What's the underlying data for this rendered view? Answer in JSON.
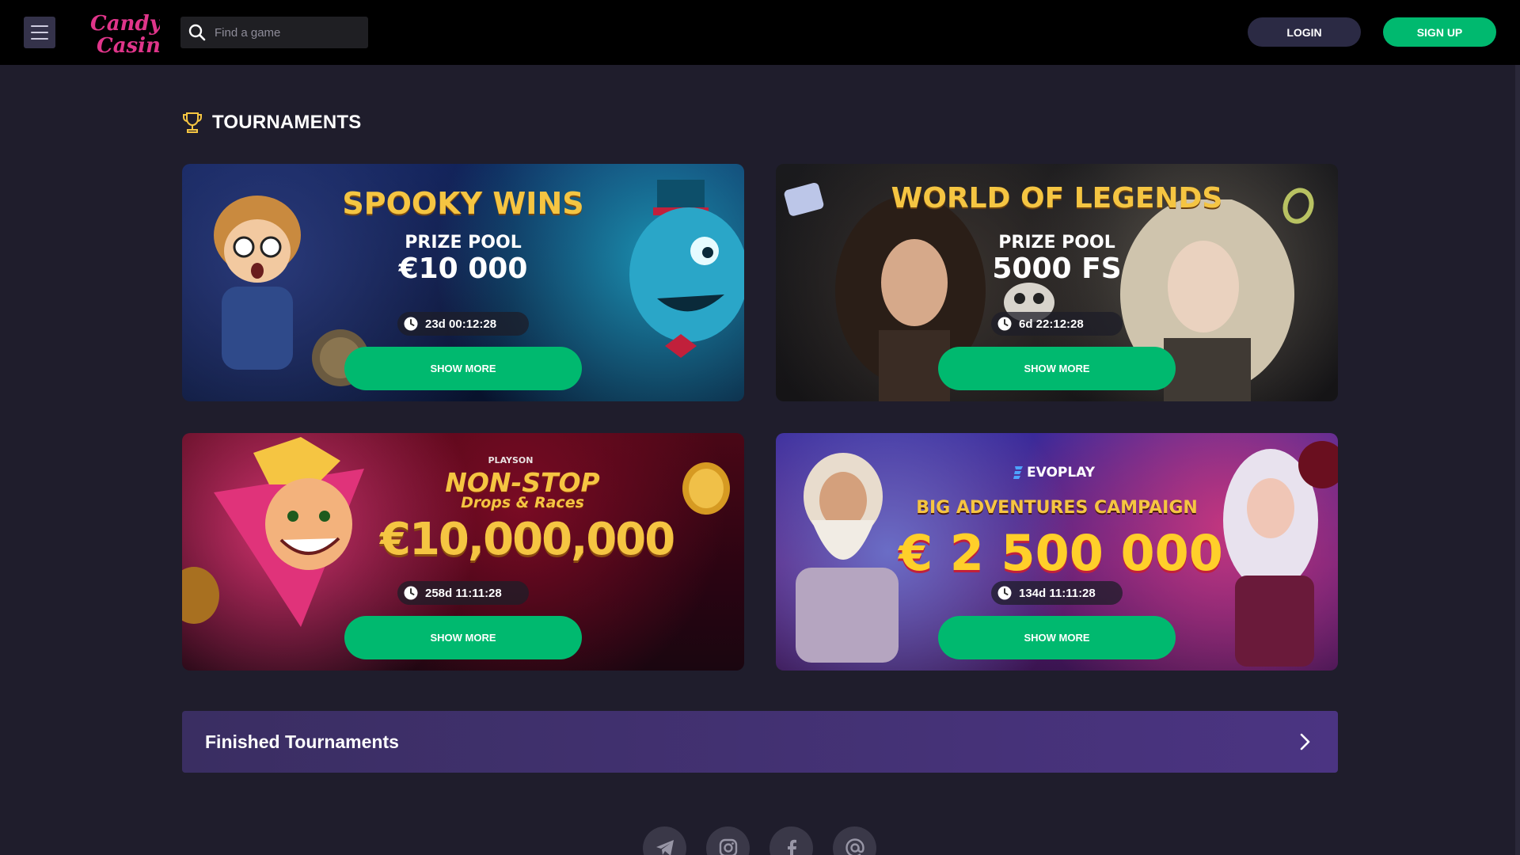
{
  "header": {
    "logo_text": "Candy Casino",
    "search_placeholder": "Find a game",
    "login_label": "LOGIN",
    "signup_label": "SIGN UP"
  },
  "section": {
    "title": "TOURNAMENTS"
  },
  "tournaments": [
    {
      "title": "SPOOKY WINS",
      "subtitle": "PRIZE POOL",
      "prize": "€10 000",
      "timer": "23d 00:12:28",
      "button": "SHOW MORE"
    },
    {
      "title": "WORLD OF LEGENDS",
      "subtitle": "PRIZE POOL",
      "prize": "5000 FS",
      "timer": "6d 22:12:28",
      "button": "SHOW MORE"
    },
    {
      "provider": "PLAYSON",
      "title": "NON-STOP",
      "subtitle": "Drops & Races",
      "prize": "€10,000,000",
      "timer": "258d 11:11:28",
      "button": "SHOW MORE"
    },
    {
      "provider": "EVOPLAY",
      "title": "BIG ADVENTURES CAMPAIGN",
      "prize": "€ 2 500 000",
      "timer": "134d 11:11:28",
      "button": "SHOW MORE"
    }
  ],
  "finished": {
    "label": "Finished Tournaments"
  },
  "socials": [
    "telegram-icon",
    "instagram-icon",
    "facebook-icon",
    "email-icon"
  ],
  "colors": {
    "background": "#1f1d2c",
    "header": "#000000",
    "accent_green": "#00b96f",
    "login_bg": "#2b2a44",
    "brand_pink": "#e0358a",
    "title_gold": "#f5c542"
  }
}
